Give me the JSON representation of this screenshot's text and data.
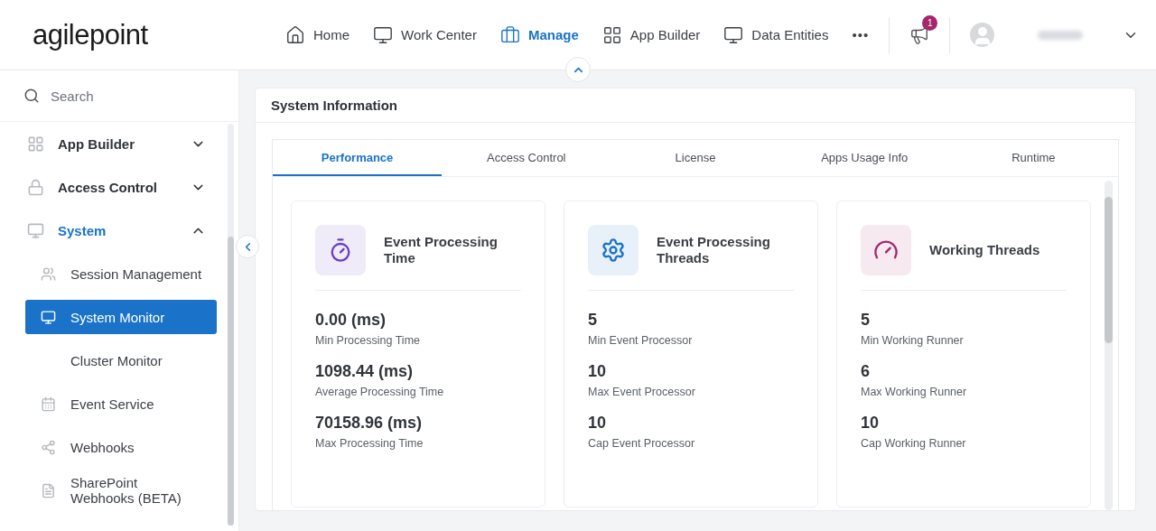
{
  "logo": "agilepoint",
  "nav": [
    {
      "label": "Home",
      "selected": false
    },
    {
      "label": "Work Center",
      "selected": false
    },
    {
      "label": "Manage",
      "selected": true
    },
    {
      "label": "App Builder",
      "selected": false
    },
    {
      "label": "Data Entities",
      "selected": false
    }
  ],
  "more": "•••",
  "notifications": {
    "count": "1"
  },
  "sidebar": {
    "search": {
      "placeholder": "Search"
    },
    "groups": [
      {
        "label": "App Builder",
        "selected": false,
        "expanded": false
      },
      {
        "label": "Access Control",
        "selected": false,
        "expanded": false
      },
      {
        "label": "System",
        "selected": true,
        "expanded": true,
        "children": [
          {
            "label": "Session Management",
            "selected": false
          },
          {
            "label": "System Monitor",
            "selected": true
          },
          {
            "label": "Cluster Monitor",
            "selected": false
          },
          {
            "label": "Event Service",
            "selected": false
          },
          {
            "label": "Webhooks",
            "selected": false
          },
          {
            "label": "SharePoint Webhooks (BETA)",
            "selected": false
          }
        ]
      }
    ]
  },
  "panel": {
    "title": "System Information",
    "tabs": [
      {
        "label": "Performance",
        "selected": true
      },
      {
        "label": "Access Control",
        "selected": false
      },
      {
        "label": "License",
        "selected": false
      },
      {
        "label": "Apps Usage Info",
        "selected": false
      },
      {
        "label": "Runtime",
        "selected": false
      }
    ],
    "cards": [
      {
        "title": "Event Processing Time",
        "color": "#6b3fc4",
        "rows": [
          {
            "value": "0.00 (ms)",
            "label": "Min Processing Time"
          },
          {
            "value": "1098.44 (ms)",
            "label": "Average Processing Time"
          },
          {
            "value": "70158.96 (ms)",
            "label": "Max Processing Time"
          }
        ]
      },
      {
        "title": "Event Processing Threads",
        "color": "#1a73c8",
        "rows": [
          {
            "value": "5",
            "label": "Min Event Processor"
          },
          {
            "value": "10",
            "label": "Max Event Processor"
          },
          {
            "value": "10",
            "label": "Cap Event Processor"
          }
        ]
      },
      {
        "title": "Working Threads",
        "color": "#a3266e",
        "rows": [
          {
            "value": "5",
            "label": "Min Working Runner"
          },
          {
            "value": "6",
            "label": "Max Working Runner"
          },
          {
            "value": "10",
            "label": "Cap Working Runner"
          }
        ]
      }
    ]
  }
}
